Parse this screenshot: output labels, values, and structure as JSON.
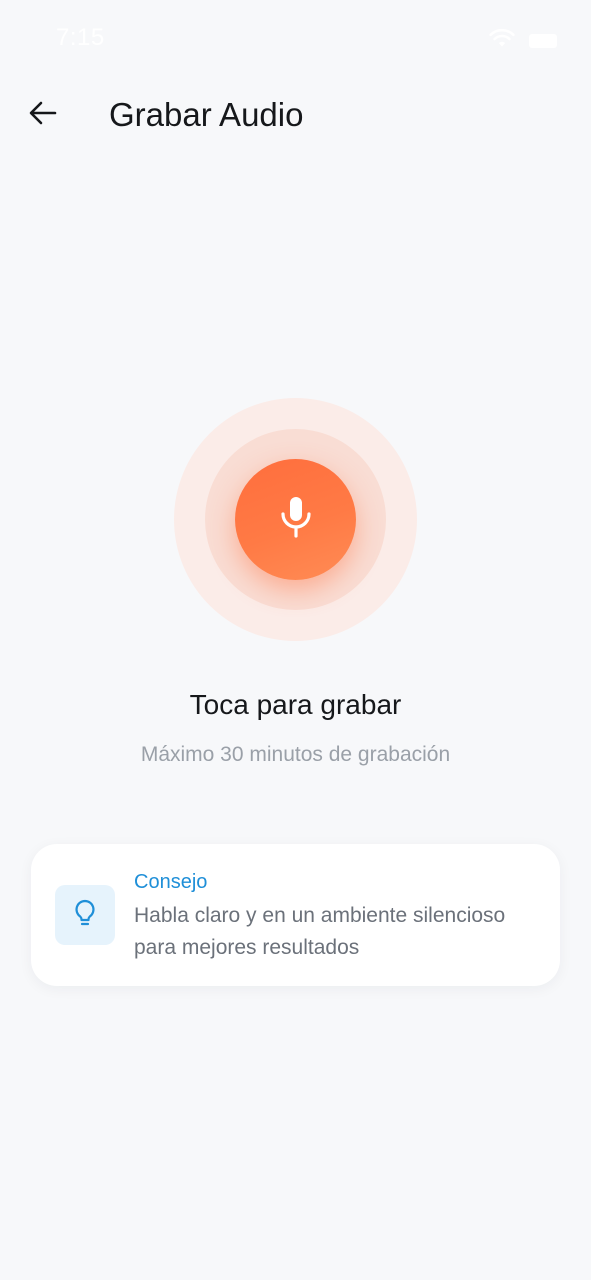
{
  "status_bar": {
    "time": "7:15",
    "icons": [
      "wifi-icon",
      "battery-icon"
    ]
  },
  "header": {
    "back_icon": "arrow-left-icon",
    "title": "Grabar Audio"
  },
  "recorder": {
    "button_icon": "microphone-icon",
    "title": "Toca para grabar",
    "subtitle": "Máximo 30 minutos de grabación"
  },
  "tip": {
    "icon": "lightbulb-icon",
    "title": "Consejo",
    "text": "Habla claro y en un ambiente silencioso para mejores resultados"
  },
  "colors": {
    "background": "#f7f8fa",
    "accent": "#ff7043",
    "tip_accent": "#1f8fd8",
    "tip_icon_bg": "#e6f3fc"
  }
}
